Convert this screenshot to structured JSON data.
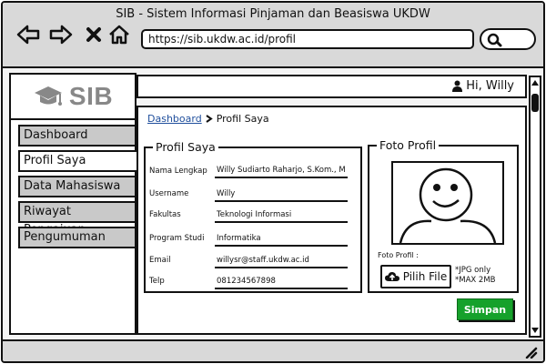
{
  "window": {
    "title": "SIB - Sistem Informasi Pinjaman dan Beasiswa UKDW",
    "url": "https://sib.ukdw.ac.id/profil"
  },
  "logo": {
    "text": "SIB",
    "icon": "graduation-cap-icon"
  },
  "sidebar": {
    "items": [
      {
        "label": "Dashboard",
        "active": false
      },
      {
        "label": "Profil Saya",
        "active": true
      },
      {
        "label": "Data Mahasiswa",
        "active": false
      },
      {
        "label": "Riwayat Pengajuan",
        "active": false
      },
      {
        "label": "Pengumuman",
        "active": false
      }
    ]
  },
  "header": {
    "greeting": "Hi, Willy",
    "icon": "user-icon"
  },
  "breadcrumb": {
    "parent": "Dashboard",
    "current": "Profil Saya"
  },
  "profile": {
    "legend": "Profil Saya",
    "fields": [
      {
        "label": "Nama Lengkap",
        "value": "Willy Sudiarto Raharjo, S.Kom., M"
      },
      {
        "label": "Username",
        "value": "Willy"
      },
      {
        "label": "Fakultas",
        "value": "Teknologi Informasi"
      },
      {
        "label": "Program Studi",
        "value": "Informatika"
      },
      {
        "label": "Email",
        "value": "willysr@staff.ukdw.ac.id"
      },
      {
        "label": "Telp",
        "value": "081234567898"
      }
    ]
  },
  "foto": {
    "legend": "Foto Profil",
    "label": "Foto Profil :",
    "button": "Pilih File",
    "button_icon": "cloud-upload-icon",
    "notes": [
      "*JPG only",
      "*MAX 2MB"
    ]
  },
  "actions": {
    "save": "Simpan",
    "save_color": "#16a12b"
  }
}
